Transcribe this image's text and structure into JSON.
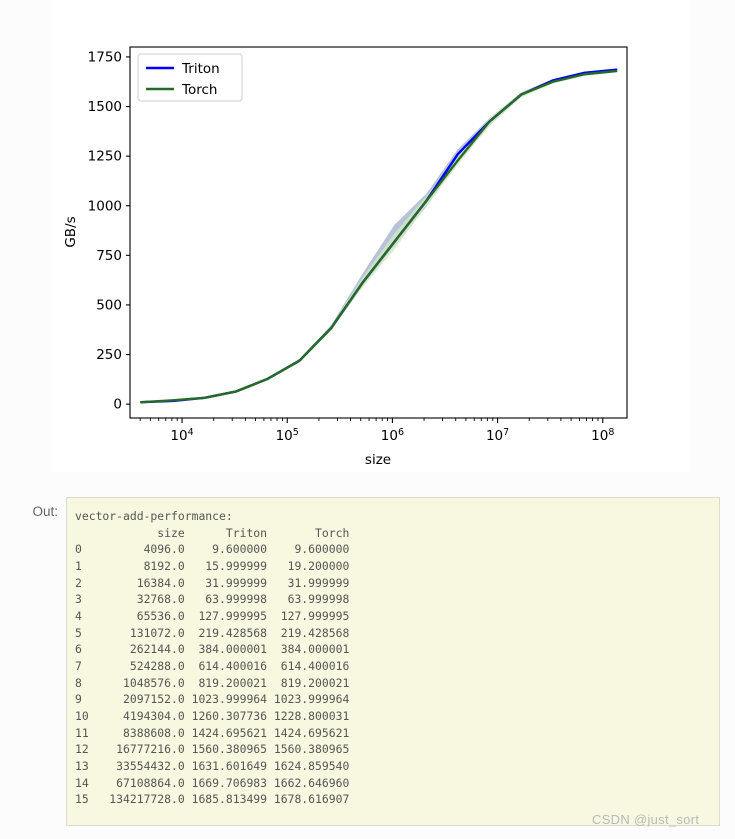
{
  "output_cell": {
    "prompt_label": "Out:",
    "caption": "vector-add-performance:",
    "columns": [
      "size",
      "Triton",
      "Torch"
    ],
    "rows": [
      {
        "index": "0",
        "size": "4096.0",
        "triton": "9.600000",
        "torch": "9.600000"
      },
      {
        "index": "1",
        "size": "8192.0",
        "triton": "15.999999",
        "torch": "19.200000"
      },
      {
        "index": "2",
        "size": "16384.0",
        "triton": "31.999999",
        "torch": "31.999999"
      },
      {
        "index": "3",
        "size": "32768.0",
        "triton": "63.999998",
        "torch": "63.999998"
      },
      {
        "index": "4",
        "size": "65536.0",
        "triton": "127.999995",
        "torch": "127.999995"
      },
      {
        "index": "5",
        "size": "131072.0",
        "triton": "219.428568",
        "torch": "219.428568"
      },
      {
        "index": "6",
        "size": "262144.0",
        "triton": "384.000001",
        "torch": "384.000001"
      },
      {
        "index": "7",
        "size": "524288.0",
        "triton": "614.400016",
        "torch": "614.400016"
      },
      {
        "index": "8",
        "size": "1048576.0",
        "triton": "819.200021",
        "torch": "819.200021"
      },
      {
        "index": "9",
        "size": "2097152.0",
        "triton": "1023.999964",
        "torch": "1023.999964"
      },
      {
        "index": "10",
        "size": "4194304.0",
        "triton": "1260.307736",
        "torch": "1228.800031"
      },
      {
        "index": "11",
        "size": "8388608.0",
        "triton": "1424.695621",
        "torch": "1424.695621"
      },
      {
        "index": "12",
        "size": "16777216.0",
        "triton": "1560.380965",
        "torch": "1560.380965"
      },
      {
        "index": "13",
        "size": "33554432.0",
        "triton": "1631.601649",
        "torch": "1624.859540"
      },
      {
        "index": "14",
        "size": "67108864.0",
        "triton": "1669.706983",
        "torch": "1662.646960"
      },
      {
        "index": "15",
        "size": "134217728.0",
        "triton": "1685.813499",
        "torch": "1678.616907"
      }
    ],
    "text": "vector-add-performance:\n            size      Triton       Torch\n0         4096.0    9.600000    9.600000\n1         8192.0   15.999999   19.200000\n2        16384.0   31.999999   31.999999\n3        32768.0   63.999998   63.999998\n4        65536.0  127.999995  127.999995\n5       131072.0  219.428568  219.428568\n6       262144.0  384.000001  384.000001\n7       524288.0  614.400016  614.400016\n8      1048576.0  819.200021  819.200021\n9      2097152.0 1023.999964 1023.999964\n10     4194304.0 1260.307736 1228.800031\n11     8388608.0 1424.695621 1424.695621\n12    16777216.0 1560.380965 1560.380965\n13    33554432.0 1631.601649 1624.859540\n14    67108864.0 1669.706983 1662.646960\n15   134217728.0 1685.813499 1678.616907"
  },
  "watermark": {
    "text": "CSDN @just_sort"
  },
  "chart_data": {
    "type": "line",
    "title": "",
    "xlabel": "size",
    "ylabel": "GB/s",
    "xscale": "log",
    "yscale": "linear",
    "xlim": [
      3200,
      170000000
    ],
    "ylim": [
      -70,
      1800
    ],
    "grid": false,
    "legend_position": "upper left",
    "xticks": [
      "10^4",
      "10^5",
      "10^6",
      "10^7",
      "10^8"
    ],
    "xtick_values": [
      10000,
      100000,
      1000000,
      10000000,
      100000000
    ],
    "yticks": [
      "0",
      "250",
      "500",
      "750",
      "1000",
      "1250",
      "1500",
      "1750"
    ],
    "ytick_values": [
      0,
      250,
      500,
      750,
      1000,
      1250,
      1500,
      1750
    ],
    "x": [
      4096,
      8192,
      16384,
      32768,
      65536,
      131072,
      262144,
      524288,
      1048576,
      2097152,
      4194304,
      8388608,
      16777216,
      33554432,
      67108864,
      134217728
    ],
    "series": [
      {
        "name": "Triton",
        "color": "#0000ff",
        "band_color": "#aab8d0",
        "values": [
          9.6,
          15.999999,
          31.999999,
          63.999998,
          127.999995,
          219.428568,
          384.000001,
          614.400016,
          819.200021,
          1023.999964,
          1260.307736,
          1424.695621,
          1560.380965,
          1631.601649,
          1669.706983,
          1685.813499
        ],
        "band_low": [
          9.0,
          15.0,
          30.5,
          62.0,
          124.0,
          212.0,
          372.0,
          596.0,
          795.0,
          995.0,
          1215.0,
          1405.0,
          1548.0,
          1625.0,
          1664.0,
          1681.0
        ],
        "band_high": [
          10.2,
          17.0,
          33.5,
          66.0,
          132.0,
          228.0,
          398.0,
          660.0,
          905.0,
          1060.0,
          1285.0,
          1442.0,
          1572.0,
          1638.0,
          1675.0,
          1690.0
        ]
      },
      {
        "name": "Torch",
        "color": "#256b25",
        "band_color": "#d6e8c8",
        "values": [
          9.6,
          19.2,
          31.999999,
          63.999998,
          127.999995,
          219.428568,
          384.000001,
          614.400016,
          819.200021,
          1023.999964,
          1228.800031,
          1424.695621,
          1560.380965,
          1624.85954,
          1662.64696,
          1678.616907
        ],
        "band_low": [
          9.0,
          18.0,
          30.5,
          62.0,
          124.0,
          210.0,
          374.0,
          590.0,
          780.0,
          1000.0,
          1205.0,
          1405.0,
          1545.0,
          1615.0,
          1655.0,
          1673.0
        ],
        "band_high": [
          10.2,
          20.4,
          33.5,
          66.0,
          132.0,
          226.0,
          394.0,
          640.0,
          860.0,
          1048.0,
          1252.0,
          1440.0,
          1572.0,
          1632.0,
          1670.0,
          1684.0
        ]
      }
    ]
  },
  "colors": {
    "triton": "#0000ff",
    "torch": "#256b25",
    "output_background": "#f8f8e0",
    "page_background": "#fcfcfc"
  }
}
